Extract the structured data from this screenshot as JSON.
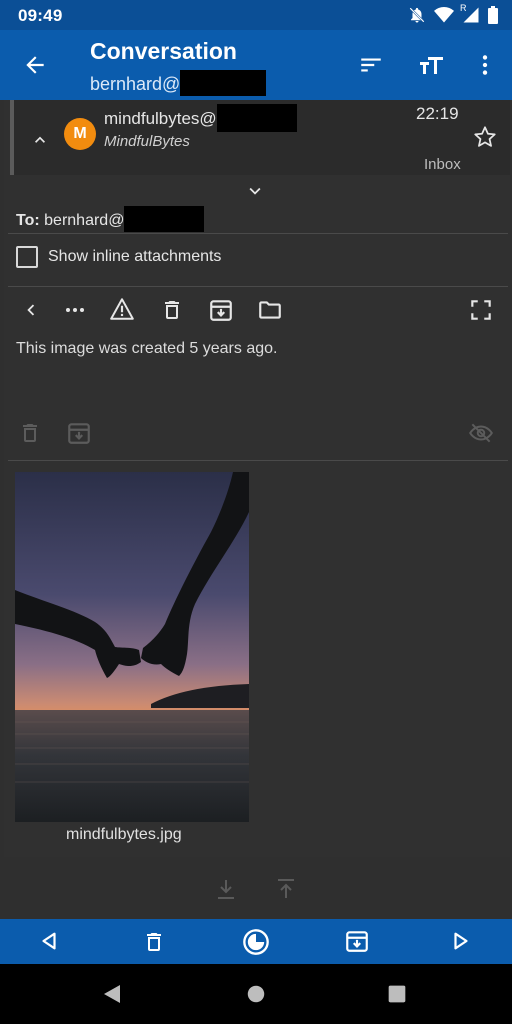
{
  "status_bar": {
    "time": "09:49",
    "network": "R"
  },
  "app_bar": {
    "title": "Conversation",
    "subtitle": "bernhard@"
  },
  "message": {
    "from_address": "mindfulbytes@",
    "from_name": "MindfulBytes",
    "avatar_letter": "M",
    "time": "22:19",
    "folder": "Inbox",
    "to_label": "To:",
    "to_address": "bernhard@",
    "inline_attachments_label": "Show inline attachments",
    "body_text": "This image was created 5 years ago.",
    "attachment_filename": "mindfulbytes.jpg"
  },
  "colors": {
    "primary": "#0b5cad",
    "status_bar": "#0b4f96",
    "avatar": "#f28c0f",
    "background": "#2f2f2f"
  },
  "icons": {
    "app_bar": [
      "back-arrow-icon",
      "sort-icon",
      "text-size-icon",
      "more-vert-icon"
    ],
    "toolbar": [
      "chevron-left-icon",
      "more-horiz-icon",
      "warning-icon",
      "delete-icon",
      "archive-icon",
      "folder-icon",
      "fullscreen-icon"
    ],
    "bottom_bar": [
      "previous-icon",
      "delete-icon",
      "snooze-icon",
      "archive-icon",
      "next-icon"
    ]
  }
}
